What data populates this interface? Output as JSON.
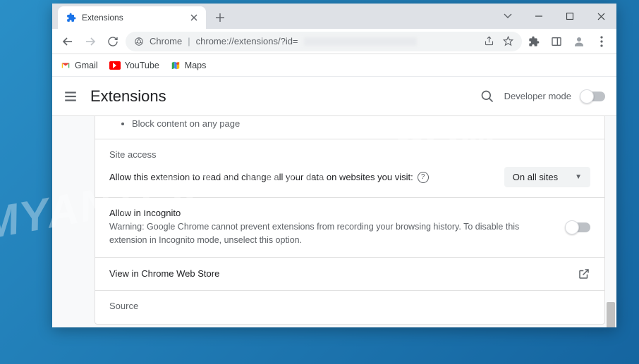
{
  "watermark": "MYANTISPYWARE.COM",
  "tab": {
    "title": "Extensions"
  },
  "omnibox": {
    "origin_label": "Chrome",
    "url": "chrome://extensions/?id="
  },
  "bookmarks": [
    {
      "name": "gmail",
      "label": "Gmail"
    },
    {
      "name": "youtube",
      "label": "YouTube"
    },
    {
      "name": "maps",
      "label": "Maps"
    }
  ],
  "header": {
    "title": "Extensions",
    "developer_mode_label": "Developer mode",
    "developer_mode_on": false
  },
  "detail": {
    "permissions_bullet": "Block content on any page",
    "site_access": {
      "heading": "Site access",
      "prompt": "Allow this extension to read and change all your data on websites you visit:",
      "selected": "On all sites"
    },
    "incognito": {
      "heading": "Allow in Incognito",
      "warning": "Warning: Google Chrome cannot prevent extensions from recording your browsing history. To disable this extension in Incognito mode, unselect this option.",
      "enabled": false
    },
    "webstore_link": "View in Chrome Web Store",
    "source_heading": "Source"
  }
}
